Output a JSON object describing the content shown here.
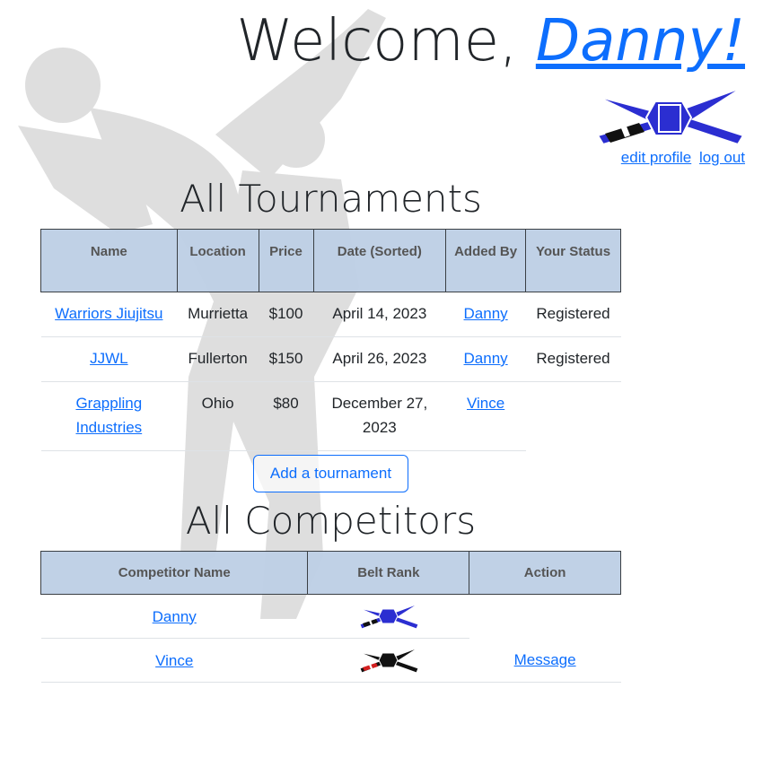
{
  "header": {
    "welcome_prefix": "Welcome, ",
    "username": "Danny!",
    "edit_profile": "edit profile",
    "log_out": "log out",
    "belt_color": "#2b2ed1"
  },
  "tournaments": {
    "title": "All Tournaments",
    "columns": [
      "Name",
      "Location",
      "Price",
      "Date (Sorted)",
      "Added By",
      "Your Status"
    ],
    "rows": [
      {
        "name": "Warriors Jiujitsu",
        "location": "Murrietta",
        "price": "$100",
        "date": "April 14, 2023",
        "added_by": "Danny",
        "status": "Registered"
      },
      {
        "name": "JJWL",
        "location": "Fullerton",
        "price": "$150",
        "date": "April 26, 2023",
        "added_by": "Danny",
        "status": "Registered"
      },
      {
        "name": "Grappling Industries",
        "location": "Ohio",
        "price": "$80",
        "date": "December 27, 2023",
        "added_by": "Vince",
        "status": ""
      }
    ],
    "add_button": "Add a tournament"
  },
  "competitors": {
    "title": "All Competitors",
    "columns": [
      "Competitor Name",
      "Belt Rank",
      "Action"
    ],
    "rows": [
      {
        "name": "Danny",
        "belt": "blue-belt-icon",
        "belt_color": "#2b2ed1",
        "action": ""
      },
      {
        "name": "Vince",
        "belt": "black-belt-icon",
        "belt_color": "#111111",
        "action": "Message"
      }
    ]
  }
}
